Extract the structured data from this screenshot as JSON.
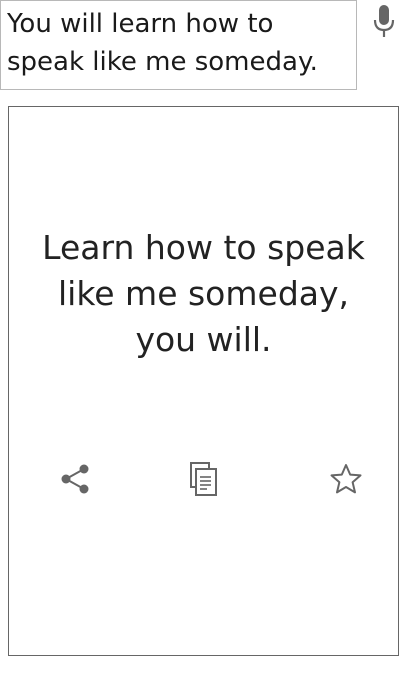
{
  "input": {
    "text": "You will learn how to speak like me someday."
  },
  "card": {
    "translation": "Learn how to speak like me someday, you will."
  },
  "icons": {
    "mic": "microphone-icon",
    "share": "share-icon",
    "copy": "copy-icon",
    "favorite": "star-icon"
  },
  "colors": {
    "icon": "#666666",
    "text": "#222222",
    "border": "#b8b8b8"
  }
}
